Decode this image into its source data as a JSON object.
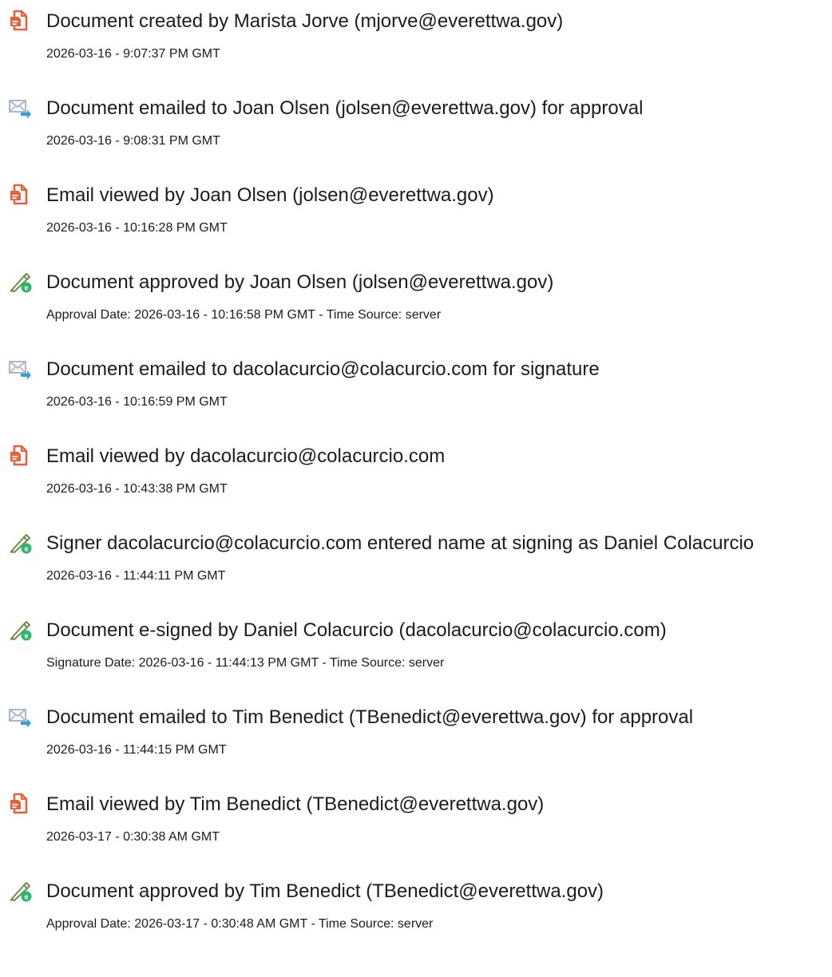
{
  "colors": {
    "document_icon": "#e8603c",
    "email_icon_envelope": "#a9b6cf",
    "email_icon_arrow": "#2f9fe0",
    "sign_icon_pen": "#6a8f47",
    "sign_icon_badge": "#2bb673"
  },
  "events": [
    {
      "icon": "document-icon",
      "title": "Document created by Marista Jorve (mjorve@everettwa.gov)",
      "detail": "2026-03-16 - 9:07:37 PM GMT"
    },
    {
      "icon": "email-icon",
      "title": "Document emailed to Joan Olsen (jolsen@everettwa.gov) for approval",
      "detail": "2026-03-16 - 9:08:31 PM GMT"
    },
    {
      "icon": "document-icon",
      "title": "Email viewed by Joan Olsen (jolsen@everettwa.gov)",
      "detail": "2026-03-16 - 10:16:28 PM GMT"
    },
    {
      "icon": "signature-icon",
      "title": "Document approved by Joan Olsen (jolsen@everettwa.gov)",
      "detail": "Approval Date: 2026-03-16 - 10:16:58 PM GMT - Time Source: server"
    },
    {
      "icon": "email-icon",
      "title": "Document emailed to dacolacurcio@colacurcio.com for signature",
      "detail": "2026-03-16 - 10:16:59 PM GMT"
    },
    {
      "icon": "document-icon",
      "title": "Email viewed by dacolacurcio@colacurcio.com",
      "detail": "2026-03-16 - 10:43:38 PM GMT"
    },
    {
      "icon": "signature-icon",
      "title": "Signer dacolacurcio@colacurcio.com entered name at signing as Daniel Colacurcio",
      "detail": "2026-03-16 - 11:44:11 PM GMT"
    },
    {
      "icon": "signature-icon",
      "title": "Document e-signed by Daniel Colacurcio (dacolacurcio@colacurcio.com)",
      "detail": "Signature Date: 2026-03-16 - 11:44:13 PM GMT - Time Source: server"
    },
    {
      "icon": "email-icon",
      "title": "Document emailed to Tim Benedict (TBenedict@everettwa.gov) for approval",
      "detail": "2026-03-16 - 11:44:15 PM GMT"
    },
    {
      "icon": "document-icon",
      "title": "Email viewed by Tim Benedict (TBenedict@everettwa.gov)",
      "detail": "2026-03-17 - 0:30:38 AM GMT"
    },
    {
      "icon": "signature-icon",
      "title": "Document approved by Tim Benedict (TBenedict@everettwa.gov)",
      "detail": "Approval Date: 2026-03-17 - 0:30:48 AM GMT - Time Source: server"
    }
  ]
}
